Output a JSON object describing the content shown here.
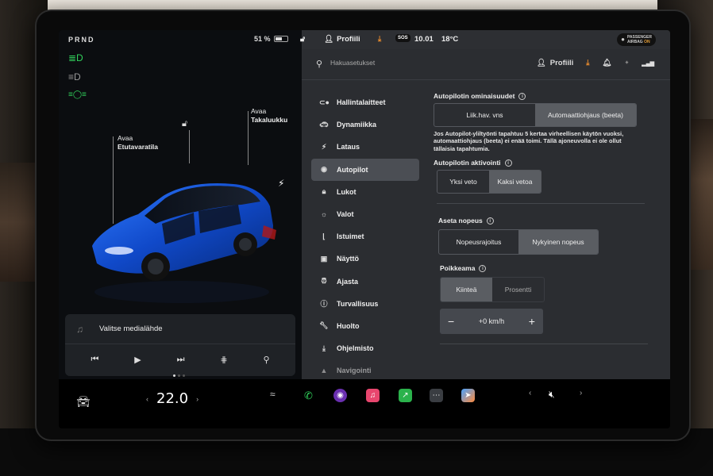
{
  "left_panel": {
    "gear": "PRND",
    "battery_percent": "51 %",
    "indicators": [
      {
        "icon": "headlights-icon",
        "glyph": "≣D"
      },
      {
        "icon": "auto-headlights-icon",
        "glyph": "≡D"
      },
      {
        "icon": "parking-lights-icon",
        "glyph": "≡◯≡"
      }
    ],
    "frunk_label_1": "Avaa",
    "frunk_label_2": "Etutavaratila",
    "trunk_label_1": "Avaa",
    "trunk_label_2": "Takaluukku",
    "media_source": "Valitse medialähde"
  },
  "status_bar": {
    "profile": "Profiili",
    "sos": "SOS",
    "time": "10.01",
    "temperature": "18°C",
    "airbag_line1": "PASSENGER",
    "airbag_line2": "AIRBAG",
    "airbag_state": "ON"
  },
  "search": {
    "placeholder": "Hakuasetukset",
    "profile": "Profiili"
  },
  "menu": [
    {
      "label": "Hallintalaitteet",
      "icon": "toggle-icon",
      "glyph": "⊂●"
    },
    {
      "label": "Dynamiikka",
      "icon": "car-icon",
      "glyph": "🚗︎"
    },
    {
      "label": "Lataus",
      "icon": "bolt-icon",
      "glyph": "⚡︎"
    },
    {
      "label": "Autopilot",
      "icon": "steering-wheel-icon",
      "glyph": "◉"
    },
    {
      "label": "Lukot",
      "icon": "lock-icon",
      "glyph": "🔒︎"
    },
    {
      "label": "Valot",
      "icon": "sun-icon",
      "glyph": "☼"
    },
    {
      "label": "Istuimet",
      "icon": "seat-icon",
      "glyph": "⌊"
    },
    {
      "label": "Näyttö",
      "icon": "display-icon",
      "glyph": "▣"
    },
    {
      "label": "Ajasta",
      "icon": "alarm-icon",
      "glyph": "⏰︎"
    },
    {
      "label": "Turvallisuus",
      "icon": "safety-icon",
      "glyph": "ⓘ"
    },
    {
      "label": "Huolto",
      "icon": "wrench-icon",
      "glyph": "🔧︎"
    },
    {
      "label": "Ohjelmisto",
      "icon": "download-icon",
      "glyph": "⤓"
    },
    {
      "label": "Navigointi",
      "icon": "navigation-icon",
      "glyph": "▲"
    }
  ],
  "active_menu": "Autopilot",
  "autopilot": {
    "features_title": "Autopilotin ominaisuudet",
    "features_options": [
      "Liik.hav. vns",
      "Automaattiohjaus (beeta)"
    ],
    "features_selected": 1,
    "features_note": "Jos Autopilot-yliltyönti tapahtuu 5 kertaa virheellisen käytön vuoksi, automaattiohjaus (beeta) ei enää toimi. Tällä ajoneuvolla ei ole ollut tällaisia tapahtumia.",
    "activation_title": "Autopilotin aktivointi",
    "activation_options": [
      "Yksi veto",
      "Kaksi vetoa"
    ],
    "activation_selected": 1,
    "speed_title": "Aseta nopeus",
    "speed_options": [
      "Nopeusrajoitus",
      "Nykyinen nopeus"
    ],
    "speed_selected": 1,
    "offset_title": "Poikkeama",
    "offset_options": [
      "Kiinteä",
      "Prosentti"
    ],
    "offset_selected": 0,
    "offset_value": "+0 km/h",
    "minus": "−",
    "plus": "+"
  },
  "dock": {
    "temperature": "22.0",
    "temp_unit_hint": "°"
  }
}
